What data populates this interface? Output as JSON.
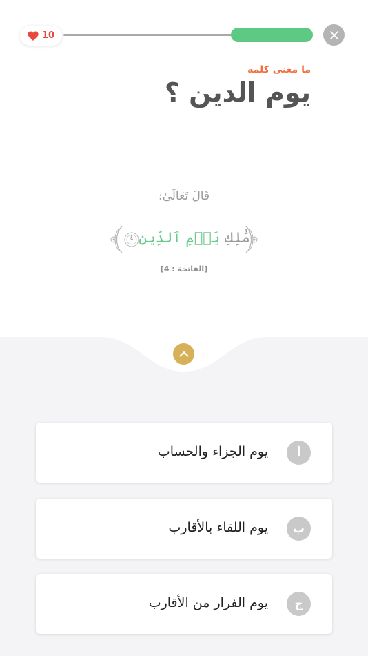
{
  "header": {
    "lives": "10",
    "lives_icon": "heart-icon",
    "progress": 0.33,
    "progress_color": "#5ec983",
    "close_icon": "close-icon"
  },
  "question": {
    "label": "ما معنى كلمة",
    "word": "يوم الدين ؟"
  },
  "verse": {
    "intro": "قَالَ تَعَالَىٰ:",
    "text_plain": "مَٰلِكِ",
    "text_highlight": "يَوۡمِ ٱلدِّينِ",
    "ayah_number": "٤",
    "reference": "[الفاتحة : 4]"
  },
  "collapse_icon": "chevron-up-icon",
  "options": [
    {
      "letter": "أ",
      "text": "يوم الجزاء والحساب"
    },
    {
      "letter": "ب",
      "text": "يوم اللقاء بالأقارب"
    },
    {
      "letter": "ج",
      "text": "يوم الفرار من الأقارب"
    }
  ],
  "colors": {
    "accent_orange": "#f07040",
    "accent_green": "#5ec983",
    "gold": "#d7b15a",
    "lives_red": "#e8493f"
  }
}
